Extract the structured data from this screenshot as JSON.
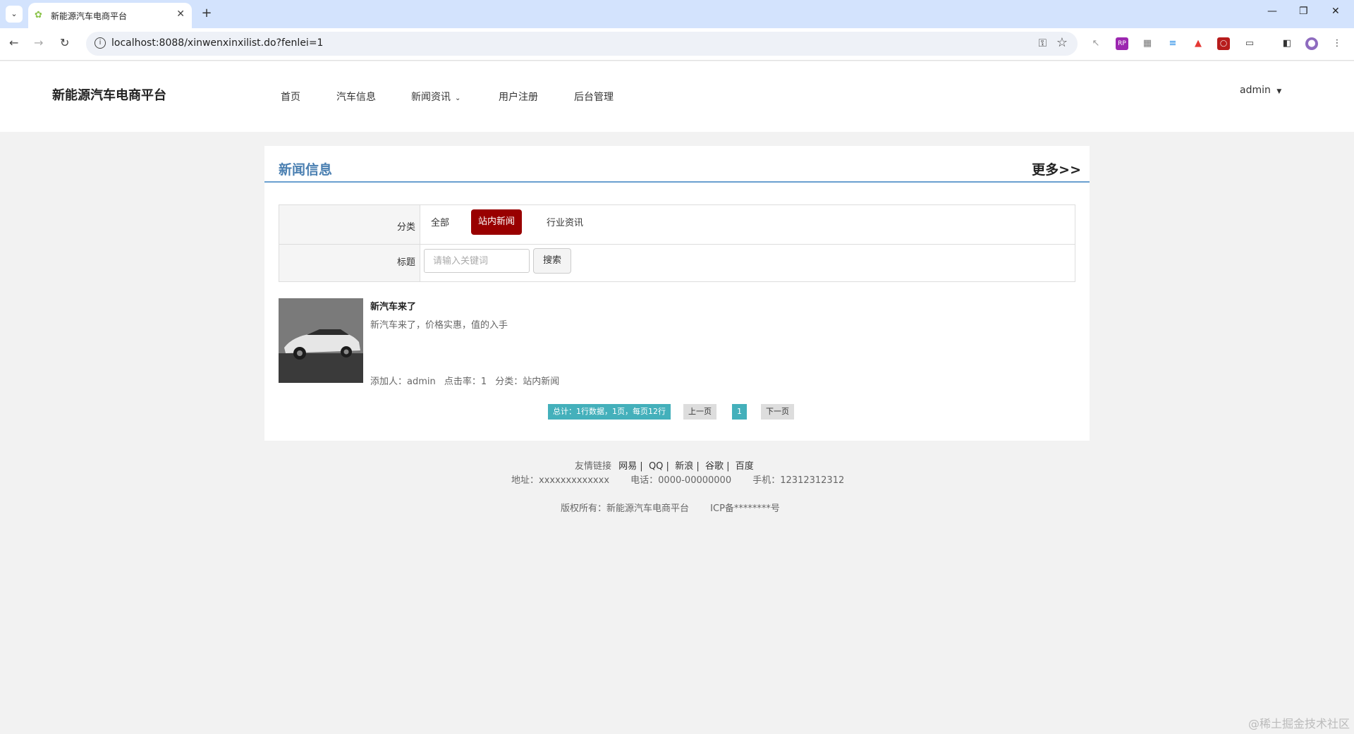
{
  "browser": {
    "tab_title": "新能源汽车电商平台",
    "url": "localhost:8088/xinwenxinxilist.do?fenlei=1"
  },
  "header": {
    "brand": "新能源汽车电商平台",
    "nav": [
      "首页",
      "汽车信息",
      "新闻资讯",
      "用户注册",
      "后台管理"
    ],
    "user": "admin"
  },
  "panel": {
    "title": "新闻信息",
    "more": "更多>>"
  },
  "filter": {
    "category_label": "分类",
    "categories": [
      "全部",
      "站内新闻",
      "行业资讯"
    ],
    "active_category": "站内新闻",
    "title_label": "标题",
    "search_placeholder": "请输入关键词",
    "search_button": "搜索"
  },
  "news": [
    {
      "title": "新汽车来了",
      "summary": "新汽车来了，价格实惠，值的入手",
      "added_by": "添加人：admin",
      "clicks": "点击率：1",
      "category": "分类：站内新闻"
    }
  ],
  "pagination": {
    "summary": "总计：1行数据，1页，每页12行",
    "prev": "上一页",
    "current": "1",
    "next": "下一页"
  },
  "footer": {
    "links_label": "友情链接",
    "links": [
      "网易 |",
      "QQ |",
      "新浪 |",
      "谷歌 |",
      "百度"
    ],
    "address": "地址：xxxxxxxxxxxxx",
    "phone": "电话：0000-00000000",
    "mobile": "手机：12312312312",
    "copyright": "版权所有：新能源汽车电商平台",
    "icp": "ICP备********号"
  },
  "watermark": "@稀土掘金技术社区",
  "colors": {
    "accent_blue": "#4a7fb1",
    "active_red": "#990000",
    "pager_teal": "#44b0bb"
  }
}
